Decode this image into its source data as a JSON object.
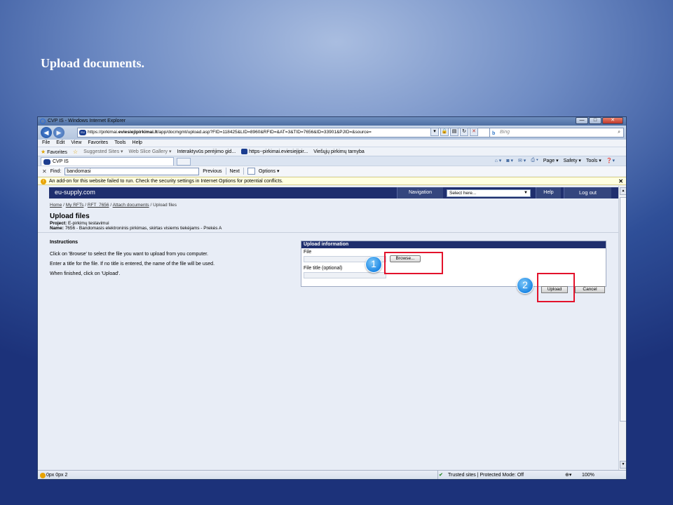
{
  "slide": {
    "title": "Upload documents."
  },
  "window": {
    "title": "CVP IS - Windows Internet Explorer",
    "minimize": "—",
    "maximize": "□",
    "close": "✕"
  },
  "address": {
    "url_prefix": "https://pirkimai.",
    "url_domain": "eviesiejipirkimai.lt",
    "url_rest": "/app/docmgmt/upload.asp?FID=118425&LID=8960&RFID=&AT=3&TID=7656&ID=33901&PJID=&source=",
    "search_placeholder": "Bing"
  },
  "menu": [
    "File",
    "Edit",
    "View",
    "Favorites",
    "Tools",
    "Help"
  ],
  "favorites": {
    "label": "Favorites",
    "items": [
      "Suggested Sites ▾",
      "Web Slice Gallery ▾",
      "Interaktyvūs perėjimo gid...",
      "https--pirkimai.eviesiejipir...",
      "Viešųjų pirkimų tarnyba"
    ]
  },
  "tab": {
    "label": "CVP IS"
  },
  "commandbar": [
    "Page ▾",
    "Safety ▾",
    "Tools ▾"
  ],
  "find": {
    "label": "Find:",
    "value": "bandomasi",
    "previous": "Previous",
    "next": "Next",
    "options": "Options ▾"
  },
  "infobar": {
    "text": "An add-on for this website failed to run. Check the security settings in Internet Options for potential conflicts."
  },
  "site": {
    "logo": "eu-supply.com",
    "navigation": "Navigation",
    "select_value": "Select here...",
    "help": "Help",
    "logout": "Log out"
  },
  "breadcrumb": {
    "items": [
      "Home",
      "My RFTs",
      "RFT_7656",
      "Attach documents"
    ],
    "current": "Upload files"
  },
  "page": {
    "title": "Upload files",
    "project_label": "Project:",
    "project_value": "E-pirkimų testavimui",
    "name_label": "Name:",
    "name_value": "7656 - Bandomasis elektroninis pirkimas, skirtas visiems tiekėjams - Prekės A"
  },
  "instructions": {
    "heading": "Instructions",
    "lines": [
      "Click on 'Browse' to select the file you want to upload from you computer.",
      "Enter a title for the file. If no title is entered, the name of the file will be used.",
      "When finished, click on 'Upload'."
    ]
  },
  "upload": {
    "heading": "Upload information",
    "file_label": "File",
    "browse": "Browse...",
    "title_label": "File title (optional)",
    "upload_button": "Upload",
    "cancel_button": "Cancel"
  },
  "callouts": [
    "1",
    "2"
  ],
  "status": {
    "left": "0px 0px 2",
    "zone": "Trusted sites | Protected Mode: Off",
    "zoom": "100%"
  },
  "colors": {
    "highlight": "#e3122b",
    "header": "#1f2f6e",
    "callout": "#1e88e5"
  }
}
